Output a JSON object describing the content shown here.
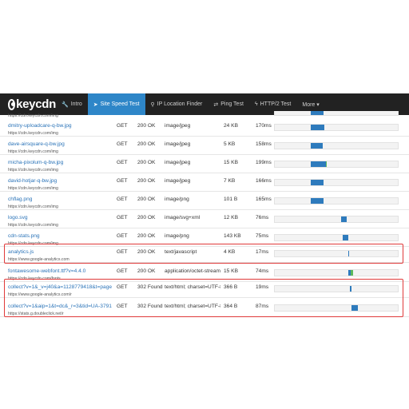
{
  "navbar": {
    "brand": "keycdn",
    "items": [
      {
        "label": "Intro",
        "icon": "wrench-icon",
        "glyph": "🔧",
        "active": false
      },
      {
        "label": "Site Speed Test",
        "icon": "paper-plane-icon",
        "glyph": "➤",
        "active": true
      },
      {
        "label": "IP Location Finder",
        "icon": "map-marker-icon",
        "glyph": "⚲",
        "active": false
      },
      {
        "label": "Ping Test",
        "icon": "exchange-icon",
        "glyph": "⇄",
        "active": false
      },
      {
        "label": "HTTP/2 Test",
        "icon": "bolt-icon",
        "glyph": "ϟ",
        "active": false
      },
      {
        "label": "More ▾",
        "icon": "",
        "glyph": "",
        "active": false
      }
    ]
  },
  "colors": {
    "nav_bg": "#222222",
    "nav_active": "#2e86c8",
    "link": "#2a73b8",
    "bar_blue": "#2e7bbd",
    "bar_green": "#5cb85c",
    "highlight": "#e03a3a"
  },
  "partial_top_host": "https://cdn.keycdn.com/img",
  "requests": [
    {
      "name": "dmitry-uploadcare-q-bw.jpg",
      "host": "https://cdn.keycdn.com/img",
      "method": "GET",
      "status": "200 OK",
      "type": "image/jpeg",
      "size": "24 KB",
      "time": "170ms",
      "wait": 0.295,
      "recv": 0.105,
      "green": 0
    },
    {
      "name": "dave-airsquare-q-bw.jpg",
      "host": "https://cdn.keycdn.com/img",
      "method": "GET",
      "status": "200 OK",
      "type": "image/jpeg",
      "size": "5 KB",
      "time": "158ms",
      "wait": 0.295,
      "recv": 0.095,
      "green": 0
    },
    {
      "name": "micha-pixolum-q-bw.jpg",
      "host": "https://cdn.keycdn.com/img",
      "method": "GET",
      "status": "200 OK",
      "type": "image/jpeg",
      "size": "15 KB",
      "time": "199ms",
      "wait": 0.295,
      "recv": 0.12,
      "green": 0.01
    },
    {
      "name": "david-hotjar-q-bw.jpg",
      "host": "https://cdn.keycdn.com/img",
      "method": "GET",
      "status": "200 OK",
      "type": "image/jpeg",
      "size": "7 KB",
      "time": "166ms",
      "wait": 0.295,
      "recv": 0.1,
      "green": 0
    },
    {
      "name": "chflag.png",
      "host": "https://cdn.keycdn.com/img",
      "method": "GET",
      "status": "200 OK",
      "type": "image/png",
      "size": "101 B",
      "time": "165ms",
      "wait": 0.295,
      "recv": 0.1,
      "green": 0
    },
    {
      "name": "logo.svg",
      "host": "https://cdn.keycdn.com/img",
      "method": "GET",
      "status": "200 OK",
      "type": "image/svg+xml",
      "size": "12 KB",
      "time": "76ms",
      "wait": 0.54,
      "recv": 0.045,
      "green": 0
    },
    {
      "name": "cdn-stats.png",
      "host": "https://cdn.keycdn.com/img",
      "method": "GET",
      "status": "200 OK",
      "type": "image/png",
      "size": "143 KB",
      "time": "75ms",
      "wait": 0.55,
      "recv": 0.045,
      "green": 0
    },
    {
      "name": "analytics.js",
      "host": "https://www.google-analytics.com",
      "method": "GET",
      "status": "200 OK",
      "type": "text/javascript",
      "size": "4 KB",
      "time": "17ms",
      "wait": 0.595,
      "recv": 0.012,
      "green": 0
    },
    {
      "name": "fontawesome-webfont.ttf?v=4.4.0",
      "host": "https://cdn.keycdn.com/fonts",
      "method": "GET",
      "status": "200 OK",
      "type": "application/octet-stream",
      "size": "15 KB",
      "time": "74ms",
      "wait": 0.595,
      "recv": 0.022,
      "green": 0.02
    },
    {
      "name": "collect?v=1&_v=j40&a=1128779418&t=pagevi...",
      "host": "https://www.google-analytics.com/r",
      "method": "GET",
      "status": "302 Found",
      "type": "text/html; charset=UTF-8",
      "size": "366 B",
      "time": "19ms",
      "wait": 0.61,
      "recv": 0.012,
      "green": 0
    },
    {
      "name": "collect?v=1&aip=1&t=dc&_r=3&tid=UA-37917...",
      "host": "https://stats.g.doubleclick.net/r",
      "method": "GET",
      "status": "302 Found",
      "type": "text/html; charset=UTF-8",
      "size": "364 B",
      "time": "87ms",
      "wait": 0.625,
      "recv": 0.05,
      "green": 0
    }
  ]
}
